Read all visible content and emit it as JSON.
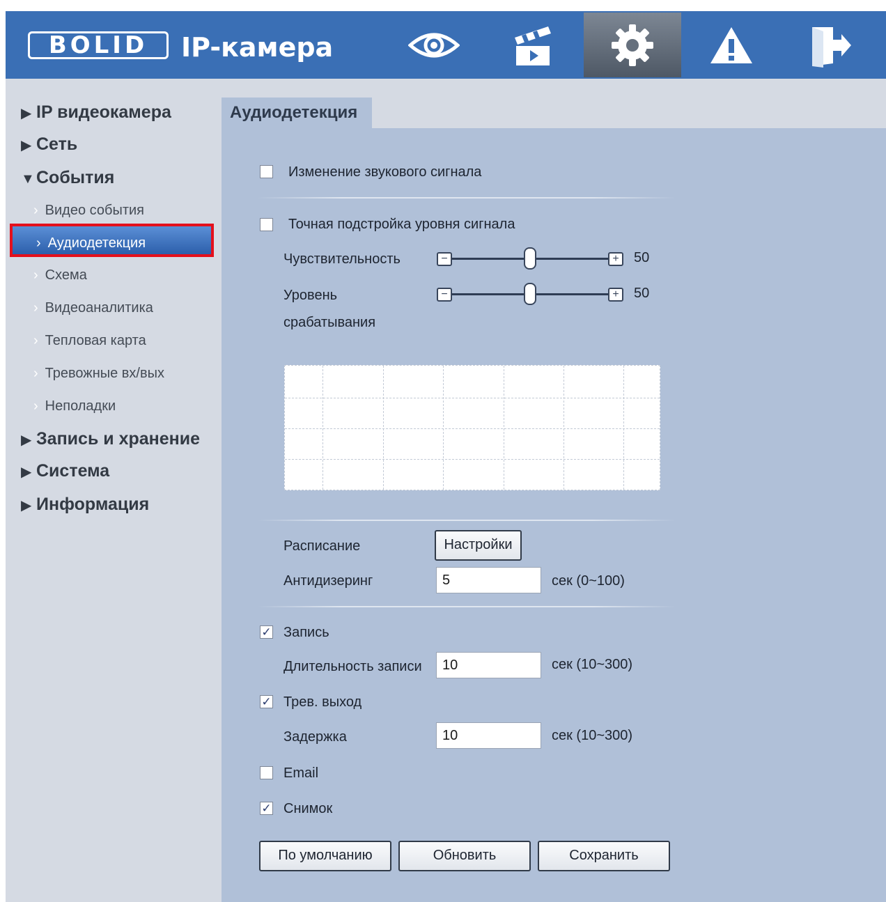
{
  "header": {
    "logo_text": "BOLID",
    "title": "IP-камера",
    "nav_icons": [
      "live-view-eye-icon",
      "playback-clapper-icon",
      "settings-gear-icon",
      "alarm-warning-icon",
      "logout-door-icon"
    ],
    "active_nav": "settings-gear-icon",
    "colors": {
      "header": "#3a6fb5",
      "sidebar": "#d5dae3",
      "panel": "#b0c0d8",
      "highlight": "#e4101c"
    }
  },
  "sidebar": {
    "sections": [
      {
        "label": "IP видеокамера",
        "expanded": false
      },
      {
        "label": "Сеть",
        "expanded": false
      },
      {
        "label": "События",
        "expanded": true
      },
      {
        "label": "Запись и хранение",
        "expanded": false
      },
      {
        "label": "Система",
        "expanded": false
      },
      {
        "label": "Информация",
        "expanded": false
      }
    ],
    "events_items": [
      {
        "label": "Видео события"
      },
      {
        "label": "Аудиодетекция",
        "active": true
      },
      {
        "label": "Схема"
      },
      {
        "label": "Видеоаналитика"
      },
      {
        "label": "Тепловая карта"
      },
      {
        "label": "Тревожные вх/вых"
      },
      {
        "label": "Неполадки"
      }
    ]
  },
  "main": {
    "tab": "Аудиодетекция",
    "audio_change": {
      "label": "Изменение звукового сигнала",
      "checked": false
    },
    "fine_tune": {
      "label": "Точная подстройка уровня сигнала",
      "checked": false
    },
    "sensitivity": {
      "label": "Чувствительность",
      "value": "50",
      "fraction": 0.5
    },
    "threshold": {
      "label_line1": "Уровень",
      "label_line2": "срабатывания",
      "value": "50",
      "fraction": 0.5
    },
    "schedule": {
      "label": "Расписание",
      "button": "Настройки"
    },
    "antidither": {
      "label": "Антидизеринг",
      "value": "5",
      "unit": "сек (0~100)"
    },
    "record": {
      "label": "Запись",
      "checked": true
    },
    "record_duration": {
      "label": "Длительность записи",
      "value": "10",
      "unit": "сек (10~300)"
    },
    "alarm_out": {
      "label": "Трев. выход",
      "checked": true
    },
    "delay": {
      "label": "Задержка",
      "value": "10",
      "unit": "сек (10~300)"
    },
    "email": {
      "label": "Email",
      "checked": false
    },
    "snapshot": {
      "label": "Снимок",
      "checked": true
    },
    "buttons": {
      "default": "По умолчанию",
      "refresh": "Обновить",
      "save": "Сохранить"
    }
  }
}
